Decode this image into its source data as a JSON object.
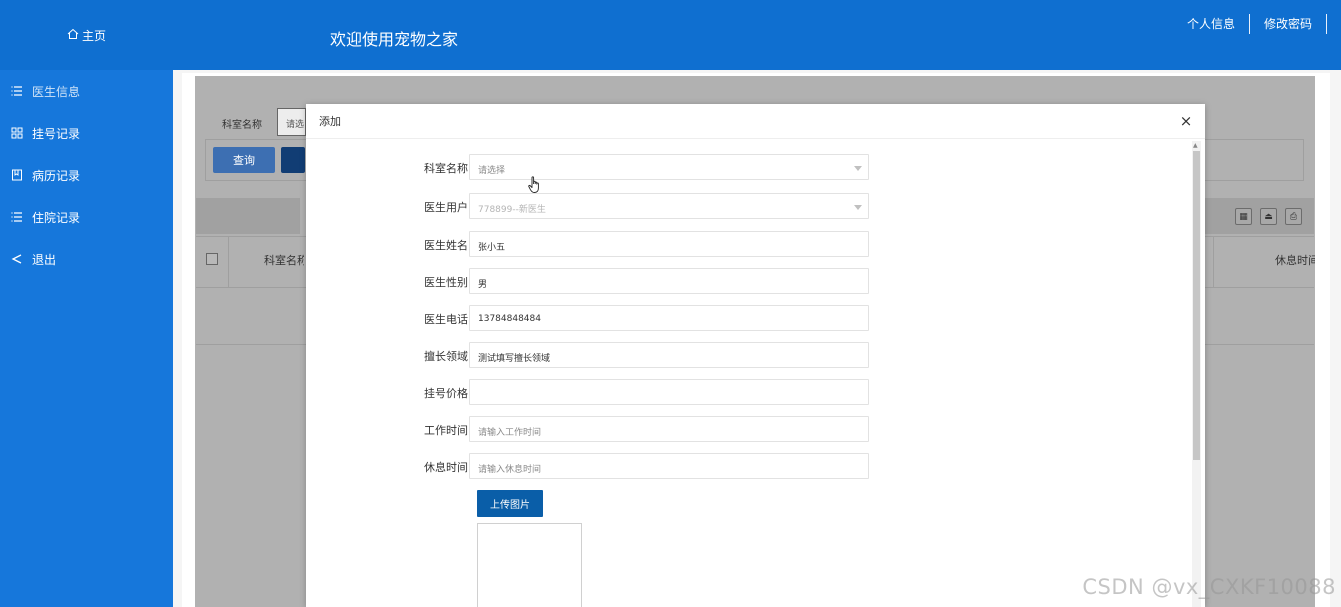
{
  "sidebar": {
    "home_label": "主页",
    "items": [
      {
        "label": "医生信息",
        "icon": "list-icon"
      },
      {
        "label": "挂号记录",
        "icon": "grid-icon"
      },
      {
        "label": "病历记录",
        "icon": "book-icon"
      },
      {
        "label": "住院记录",
        "icon": "list-icon"
      },
      {
        "label": "退出",
        "icon": "share-icon"
      }
    ]
  },
  "header": {
    "title": "欢迎使用宠物之家",
    "links": [
      "个人信息",
      "修改密码"
    ]
  },
  "background_page": {
    "filter_label": "科室名称",
    "filter_placeholder": "请选",
    "search_button": "查询",
    "table_headers": [
      "科室名称",
      "休息时间"
    ]
  },
  "modal": {
    "title": "添加",
    "close": "×",
    "fields": [
      {
        "label": "科室名称",
        "value": "请选择",
        "kind": "select",
        "state": "placeholder"
      },
      {
        "label": "医生用户",
        "value": "778899--新医生",
        "kind": "select",
        "state": "disabled"
      },
      {
        "label": "医生姓名",
        "value": "张小五",
        "kind": "input",
        "state": "filled"
      },
      {
        "label": "医生性别",
        "value": "男",
        "kind": "input",
        "state": "filled"
      },
      {
        "label": "医生电话",
        "value": "13784848484",
        "kind": "input",
        "state": "filled"
      },
      {
        "label": "擅长领域",
        "value": "测试填写擅长领域",
        "kind": "input",
        "state": "filled"
      },
      {
        "label": "挂号价格",
        "value": "",
        "kind": "input",
        "state": "filled"
      },
      {
        "label": "工作时间",
        "value": "请输入工作时间",
        "kind": "input",
        "state": "placeholder"
      },
      {
        "label": "休息时间",
        "value": "请输入休息时间",
        "kind": "input",
        "state": "placeholder"
      }
    ],
    "upload_button": "上传图片"
  },
  "watermark": "CSDN @vx_CXKF10088"
}
